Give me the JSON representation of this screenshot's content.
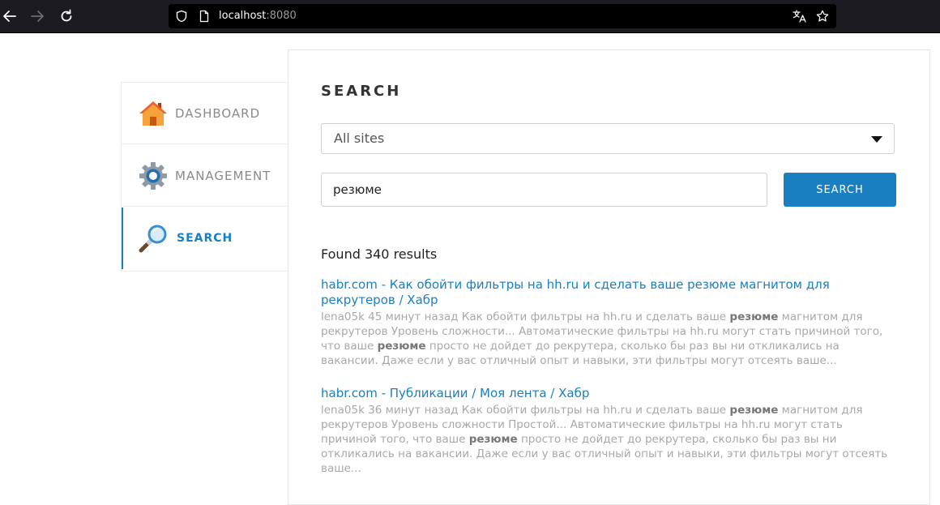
{
  "browser": {
    "url_host": "localhost",
    "url_port": ":8080"
  },
  "sidebar": {
    "items": [
      {
        "label": "DASHBOARD",
        "icon": "home-icon"
      },
      {
        "label": "MANAGEMENT",
        "icon": "gear-icon"
      },
      {
        "label": "SEARCH",
        "icon": "magnifier-icon",
        "active": true
      }
    ]
  },
  "main": {
    "title": "SEARCH",
    "site_select": {
      "selected": "All sites"
    },
    "query_value": "резюме",
    "search_button": "SEARCH",
    "results_count": "Found 340 results",
    "results": [
      {
        "title": "habr.com - Как обойти фильтры на hh.ru и сделать ваше резюме магнитом для рекрутеров / Хабр",
        "snippet": [
          {
            "t": "lena05k 45 минут назад Как обойти фильтры на hh.ru и сделать ваше "
          },
          {
            "t": "резюме",
            "b": true
          },
          {
            "t": " магнитом для рекрутеров Уровень сложности... Автоматические фильтры на hh.ru могут стать причиной того, что ваше "
          },
          {
            "t": "резюме",
            "b": true
          },
          {
            "t": " просто не дойдет до рекрутера, сколько бы раз вы ни откликались на вакансии. Даже если у вас отличный опыт и навыки, эти фильтры могут отсеять ваше..."
          }
        ]
      },
      {
        "title": "habr.com - Публикации / Моя лента / Хабр",
        "snippet": [
          {
            "t": "lena05k 36 минут назад Как обойти фильтры на hh.ru и сделать ваше "
          },
          {
            "t": "резюме",
            "b": true
          },
          {
            "t": " магнитом для рекрутеров Уровень сложности Простой... Автоматические фильтры на hh.ru могут стать причиной того, что ваше "
          },
          {
            "t": "резюме",
            "b": true
          },
          {
            "t": " просто не дойдет до рекрутера, сколько бы раз вы ни откликались на вакансии. Даже если у вас отличный опыт и навыки, эти фильтры могут отсеять ваше..."
          }
        ]
      }
    ]
  }
}
